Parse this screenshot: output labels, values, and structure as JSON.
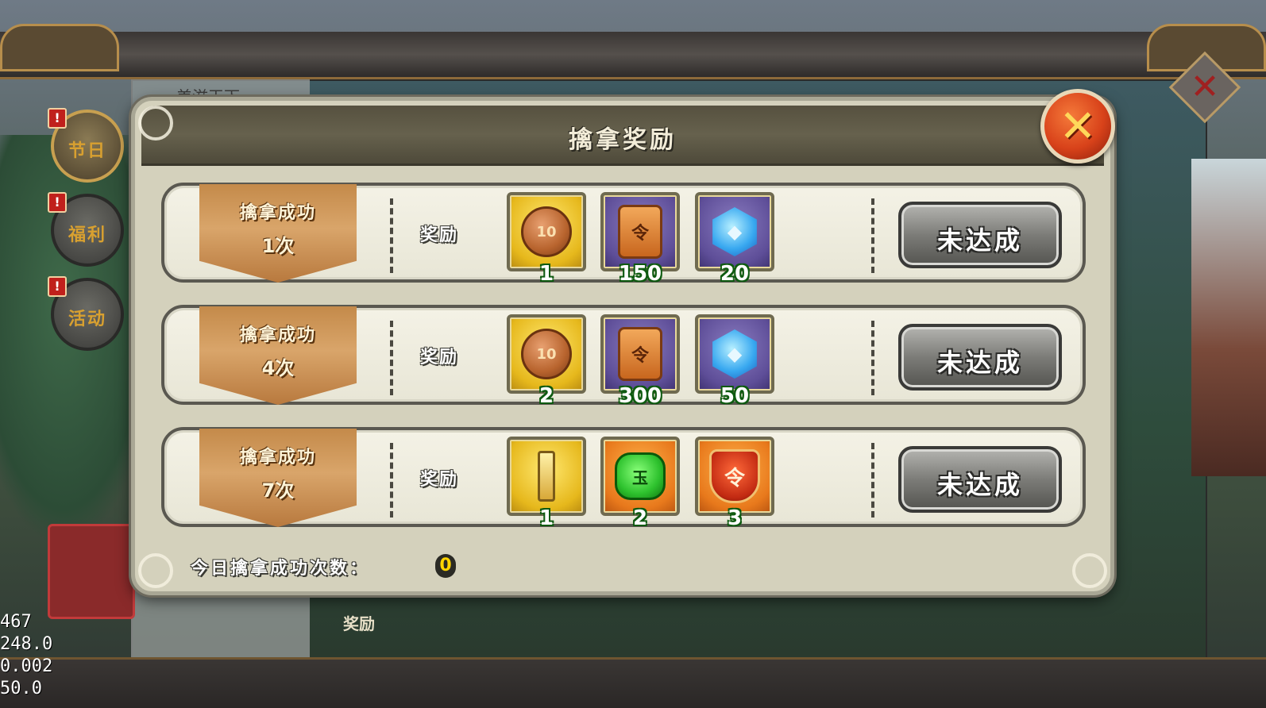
{
  "background": {
    "partial_title": "美滋天下",
    "reward_label": "奖励",
    "close_icon": "x-icon"
  },
  "side_tabs": [
    {
      "label": "节日",
      "alert": "!",
      "active": true
    },
    {
      "label": "福利",
      "alert": "!",
      "active": false
    },
    {
      "label": "活动",
      "alert": "!",
      "active": false
    }
  ],
  "debug_stats": [
    "467",
    "248.0",
    "0.002",
    "50.0"
  ],
  "modal": {
    "title": "擒拿奖励",
    "close_icon": "x-icon",
    "rows": [
      {
        "title": "擒拿成功",
        "count": "1次",
        "reward_label": "奖励",
        "status": "未达成",
        "items": [
          {
            "icon": "copper-coin-icon",
            "glyph": "10",
            "frame": "gold",
            "qty": "1"
          },
          {
            "icon": "token-pendant-icon",
            "glyph": "令",
            "frame": "purple",
            "qty": "150"
          },
          {
            "icon": "blue-crystal-icon",
            "glyph": "◆",
            "frame": "purple",
            "qty": "20"
          }
        ]
      },
      {
        "title": "擒拿成功",
        "count": "4次",
        "reward_label": "奖励",
        "status": "未达成",
        "items": [
          {
            "icon": "copper-coin-icon",
            "glyph": "10",
            "frame": "gold",
            "qty": "2"
          },
          {
            "icon": "token-pendant-icon",
            "glyph": "令",
            "frame": "purple",
            "qty": "300"
          },
          {
            "icon": "blue-crystal-icon",
            "glyph": "◆",
            "frame": "purple",
            "qty": "50"
          }
        ]
      },
      {
        "title": "擒拿成功",
        "count": "7次",
        "reward_label": "奖励",
        "status": "未达成",
        "items": [
          {
            "icon": "golden-scroll-icon",
            "glyph": "",
            "frame": "gold",
            "qty": "1"
          },
          {
            "icon": "green-jade-icon",
            "glyph": "玉",
            "frame": "orange",
            "qty": "2"
          },
          {
            "icon": "red-badge-icon",
            "glyph": "令",
            "frame": "orange",
            "qty": "3"
          }
        ]
      }
    ],
    "footer_label": "今日擒拿成功次数：",
    "footer_value": "0"
  },
  "colors": {
    "modal_bg": "#d4d1bc",
    "header_bg": "#56513f",
    "ribbon": "#c48a4a",
    "close_button": "#d8421a",
    "qty_outline": "#0e5a10",
    "status_button": "#7c7c78"
  }
}
